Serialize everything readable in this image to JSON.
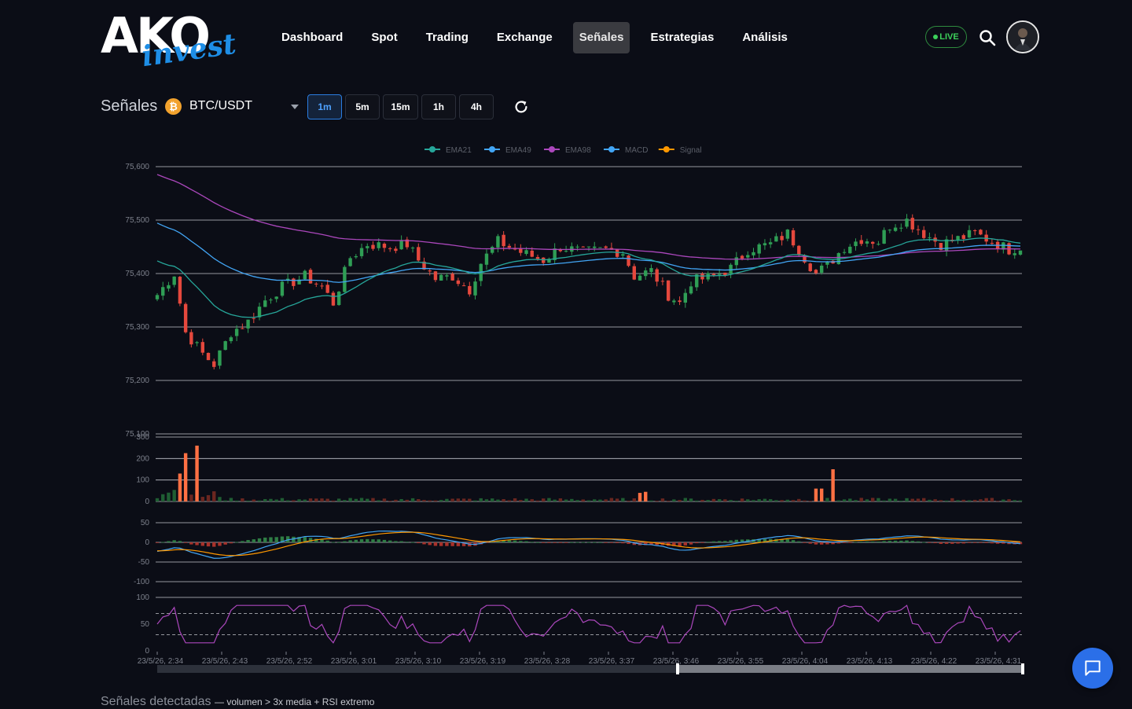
{
  "brand": {
    "name_top": "AKO",
    "name_bottom": "invest"
  },
  "nav": {
    "items": [
      "Dashboard",
      "Spot",
      "Trading",
      "Exchange",
      "Señales",
      "Estrategias",
      "Análisis"
    ],
    "active": "Señales",
    "live_label": "LIVE"
  },
  "toolbar": {
    "title": "Señales",
    "coin_symbol": "₿",
    "pair": "BTC/USDT",
    "timeframes": [
      "1m",
      "5m",
      "15m",
      "1h",
      "4h"
    ],
    "active_timeframe": "1m"
  },
  "colors": {
    "up": "#2f9e55",
    "down": "#e5483d",
    "ema21": "#26a69a",
    "ema49": "#42a5f5",
    "ema98": "#ab47bc",
    "macd": "#42a5f5",
    "signal": "#ff9800",
    "rsi": "#ab47bc",
    "volume_spike": "#ff7043"
  },
  "chart_data": {
    "type": "candlestick",
    "legend": [
      "EMA21",
      "EMA49",
      "EMA98",
      "MACD",
      "Signal"
    ],
    "legend_position": "top-center",
    "price_ticks": [
      "75,600",
      "75,500",
      "75,400",
      "75,300",
      "75,200",
      "75,100"
    ],
    "price_ylim": [
      75100,
      75600
    ],
    "volume_ticks": [
      "300",
      "200",
      "100",
      "0"
    ],
    "macd_ticks": [
      "50",
      "0",
      "-50",
      "-100"
    ],
    "rsi_ticks": [
      "100",
      "50",
      "0"
    ],
    "rsi_levels": [
      70,
      30
    ],
    "time_labels": [
      "23/5/26, 2:34",
      "23/5/26, 2:43",
      "23/5/26, 2:52",
      "23/5/26, 3:01",
      "23/5/26, 3:10",
      "23/5/26, 3:19",
      "23/5/26, 3:28",
      "23/5/26, 3:37",
      "23/5/26, 3:46",
      "23/5/26, 3:55",
      "23/5/26, 4:04",
      "23/5/26, 4:13",
      "23/5/26, 4:22",
      "23/5/26, 4:31"
    ],
    "grid": true,
    "close_keypoints": [
      {
        "t": 0,
        "v": 75360
      },
      {
        "t": 3,
        "v": 75400
      },
      {
        "t": 5,
        "v": 75290
      },
      {
        "t": 8,
        "v": 75250
      },
      {
        "t": 10,
        "v": 75230
      },
      {
        "t": 13,
        "v": 75290
      },
      {
        "t": 16,
        "v": 75310
      },
      {
        "t": 19,
        "v": 75350
      },
      {
        "t": 22,
        "v": 75375
      },
      {
        "t": 26,
        "v": 75395
      },
      {
        "t": 29,
        "v": 75375
      },
      {
        "t": 31,
        "v": 75345
      },
      {
        "t": 34,
        "v": 75430
      },
      {
        "t": 37,
        "v": 75455
      },
      {
        "t": 41,
        "v": 75450
      },
      {
        "t": 44,
        "v": 75455
      },
      {
        "t": 46,
        "v": 75425
      },
      {
        "t": 49,
        "v": 75390
      },
      {
        "t": 52,
        "v": 75395
      },
      {
        "t": 55,
        "v": 75370
      },
      {
        "t": 57,
        "v": 75420
      },
      {
        "t": 60,
        "v": 75460
      },
      {
        "t": 64,
        "v": 75440
      },
      {
        "t": 68,
        "v": 75425
      },
      {
        "t": 71,
        "v": 75450
      },
      {
        "t": 75,
        "v": 75440
      },
      {
        "t": 79,
        "v": 75445
      },
      {
        "t": 82,
        "v": 75440
      },
      {
        "t": 84,
        "v": 75395
      },
      {
        "t": 87,
        "v": 75405
      },
      {
        "t": 90,
        "v": 75360
      },
      {
        "t": 92,
        "v": 75345
      },
      {
        "t": 94,
        "v": 75385
      },
      {
        "t": 98,
        "v": 75395
      },
      {
        "t": 101,
        "v": 75410
      },
      {
        "t": 104,
        "v": 75445
      },
      {
        "t": 108,
        "v": 75455
      },
      {
        "t": 111,
        "v": 75475
      },
      {
        "t": 114,
        "v": 75430
      },
      {
        "t": 116,
        "v": 75400
      },
      {
        "t": 118,
        "v": 75415
      },
      {
        "t": 121,
        "v": 75450
      },
      {
        "t": 124,
        "v": 75465
      },
      {
        "t": 127,
        "v": 75460
      },
      {
        "t": 129,
        "v": 75490
      },
      {
        "t": 132,
        "v": 75500
      },
      {
        "t": 135,
        "v": 75475
      },
      {
        "t": 138,
        "v": 75455
      },
      {
        "t": 141,
        "v": 75465
      },
      {
        "t": 144,
        "v": 75475
      },
      {
        "t": 147,
        "v": 75460
      },
      {
        "t": 150,
        "v": 75445
      },
      {
        "t": 152,
        "v": 75450
      }
    ],
    "volume_spikes": [
      {
        "t": 4,
        "v": 130
      },
      {
        "t": 5,
        "v": 225
      },
      {
        "t": 7,
        "v": 260
      },
      {
        "t": 85,
        "v": 40
      },
      {
        "t": 86,
        "v": 45
      },
      {
        "t": 116,
        "v": 60
      },
      {
        "t": 117,
        "v": 60
      },
      {
        "t": 119,
        "v": 150
      }
    ]
  },
  "signals_section": {
    "title": "Señales detectadas",
    "subtitle": "— volumen > 3x media + RSI extremo"
  }
}
